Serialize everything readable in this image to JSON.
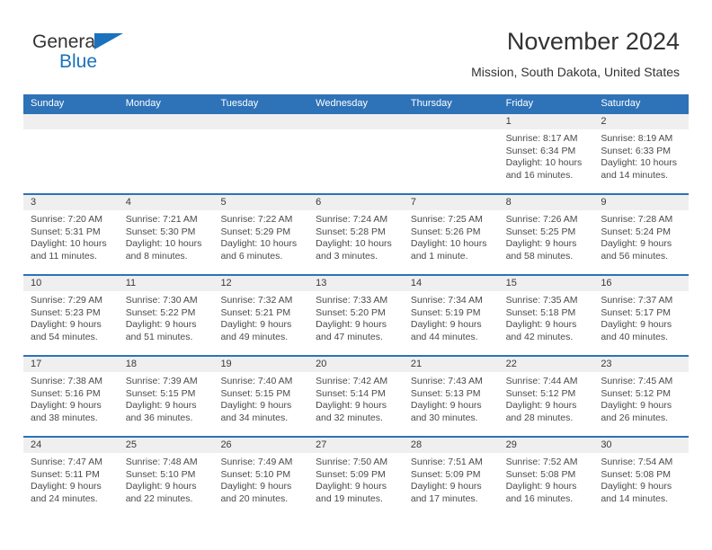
{
  "logo": {
    "line1": "General",
    "line2": "Blue",
    "triangle_color": "#1a72bd"
  },
  "header": {
    "title": "November 2024",
    "subtitle": "Mission, South Dakota, United States"
  },
  "theme": {
    "header_blue": "#2E72B8",
    "day_band_gray": "#EFEFEF",
    "text_color": "#333333"
  },
  "labels": {
    "sunrise_prefix": "Sunrise:",
    "sunset_prefix": "Sunset:",
    "daylight_prefix": "Daylight:"
  },
  "weekdays": [
    "Sunday",
    "Monday",
    "Tuesday",
    "Wednesday",
    "Thursday",
    "Friday",
    "Saturday"
  ],
  "weeks": [
    [
      {
        "day": "",
        "sunrise": "",
        "sunset": "",
        "daylight1": "",
        "daylight2": ""
      },
      {
        "day": "",
        "sunrise": "",
        "sunset": "",
        "daylight1": "",
        "daylight2": ""
      },
      {
        "day": "",
        "sunrise": "",
        "sunset": "",
        "daylight1": "",
        "daylight2": ""
      },
      {
        "day": "",
        "sunrise": "",
        "sunset": "",
        "daylight1": "",
        "daylight2": ""
      },
      {
        "day": "",
        "sunrise": "",
        "sunset": "",
        "daylight1": "",
        "daylight2": ""
      },
      {
        "day": "1",
        "sunrise": "Sunrise: 8:17 AM",
        "sunset": "Sunset: 6:34 PM",
        "daylight1": "Daylight: 10 hours",
        "daylight2": "and 16 minutes."
      },
      {
        "day": "2",
        "sunrise": "Sunrise: 8:19 AM",
        "sunset": "Sunset: 6:33 PM",
        "daylight1": "Daylight: 10 hours",
        "daylight2": "and 14 minutes."
      }
    ],
    [
      {
        "day": "3",
        "sunrise": "Sunrise: 7:20 AM",
        "sunset": "Sunset: 5:31 PM",
        "daylight1": "Daylight: 10 hours",
        "daylight2": "and 11 minutes."
      },
      {
        "day": "4",
        "sunrise": "Sunrise: 7:21 AM",
        "sunset": "Sunset: 5:30 PM",
        "daylight1": "Daylight: 10 hours",
        "daylight2": "and 8 minutes."
      },
      {
        "day": "5",
        "sunrise": "Sunrise: 7:22 AM",
        "sunset": "Sunset: 5:29 PM",
        "daylight1": "Daylight: 10 hours",
        "daylight2": "and 6 minutes."
      },
      {
        "day": "6",
        "sunrise": "Sunrise: 7:24 AM",
        "sunset": "Sunset: 5:28 PM",
        "daylight1": "Daylight: 10 hours",
        "daylight2": "and 3 minutes."
      },
      {
        "day": "7",
        "sunrise": "Sunrise: 7:25 AM",
        "sunset": "Sunset: 5:26 PM",
        "daylight1": "Daylight: 10 hours",
        "daylight2": "and 1 minute."
      },
      {
        "day": "8",
        "sunrise": "Sunrise: 7:26 AM",
        "sunset": "Sunset: 5:25 PM",
        "daylight1": "Daylight: 9 hours",
        "daylight2": "and 58 minutes."
      },
      {
        "day": "9",
        "sunrise": "Sunrise: 7:28 AM",
        "sunset": "Sunset: 5:24 PM",
        "daylight1": "Daylight: 9 hours",
        "daylight2": "and 56 minutes."
      }
    ],
    [
      {
        "day": "10",
        "sunrise": "Sunrise: 7:29 AM",
        "sunset": "Sunset: 5:23 PM",
        "daylight1": "Daylight: 9 hours",
        "daylight2": "and 54 minutes."
      },
      {
        "day": "11",
        "sunrise": "Sunrise: 7:30 AM",
        "sunset": "Sunset: 5:22 PM",
        "daylight1": "Daylight: 9 hours",
        "daylight2": "and 51 minutes."
      },
      {
        "day": "12",
        "sunrise": "Sunrise: 7:32 AM",
        "sunset": "Sunset: 5:21 PM",
        "daylight1": "Daylight: 9 hours",
        "daylight2": "and 49 minutes."
      },
      {
        "day": "13",
        "sunrise": "Sunrise: 7:33 AM",
        "sunset": "Sunset: 5:20 PM",
        "daylight1": "Daylight: 9 hours",
        "daylight2": "and 47 minutes."
      },
      {
        "day": "14",
        "sunrise": "Sunrise: 7:34 AM",
        "sunset": "Sunset: 5:19 PM",
        "daylight1": "Daylight: 9 hours",
        "daylight2": "and 44 minutes."
      },
      {
        "day": "15",
        "sunrise": "Sunrise: 7:35 AM",
        "sunset": "Sunset: 5:18 PM",
        "daylight1": "Daylight: 9 hours",
        "daylight2": "and 42 minutes."
      },
      {
        "day": "16",
        "sunrise": "Sunrise: 7:37 AM",
        "sunset": "Sunset: 5:17 PM",
        "daylight1": "Daylight: 9 hours",
        "daylight2": "and 40 minutes."
      }
    ],
    [
      {
        "day": "17",
        "sunrise": "Sunrise: 7:38 AM",
        "sunset": "Sunset: 5:16 PM",
        "daylight1": "Daylight: 9 hours",
        "daylight2": "and 38 minutes."
      },
      {
        "day": "18",
        "sunrise": "Sunrise: 7:39 AM",
        "sunset": "Sunset: 5:15 PM",
        "daylight1": "Daylight: 9 hours",
        "daylight2": "and 36 minutes."
      },
      {
        "day": "19",
        "sunrise": "Sunrise: 7:40 AM",
        "sunset": "Sunset: 5:15 PM",
        "daylight1": "Daylight: 9 hours",
        "daylight2": "and 34 minutes."
      },
      {
        "day": "20",
        "sunrise": "Sunrise: 7:42 AM",
        "sunset": "Sunset: 5:14 PM",
        "daylight1": "Daylight: 9 hours",
        "daylight2": "and 32 minutes."
      },
      {
        "day": "21",
        "sunrise": "Sunrise: 7:43 AM",
        "sunset": "Sunset: 5:13 PM",
        "daylight1": "Daylight: 9 hours",
        "daylight2": "and 30 minutes."
      },
      {
        "day": "22",
        "sunrise": "Sunrise: 7:44 AM",
        "sunset": "Sunset: 5:12 PM",
        "daylight1": "Daylight: 9 hours",
        "daylight2": "and 28 minutes."
      },
      {
        "day": "23",
        "sunrise": "Sunrise: 7:45 AM",
        "sunset": "Sunset: 5:12 PM",
        "daylight1": "Daylight: 9 hours",
        "daylight2": "and 26 minutes."
      }
    ],
    [
      {
        "day": "24",
        "sunrise": "Sunrise: 7:47 AM",
        "sunset": "Sunset: 5:11 PM",
        "daylight1": "Daylight: 9 hours",
        "daylight2": "and 24 minutes."
      },
      {
        "day": "25",
        "sunrise": "Sunrise: 7:48 AM",
        "sunset": "Sunset: 5:10 PM",
        "daylight1": "Daylight: 9 hours",
        "daylight2": "and 22 minutes."
      },
      {
        "day": "26",
        "sunrise": "Sunrise: 7:49 AM",
        "sunset": "Sunset: 5:10 PM",
        "daylight1": "Daylight: 9 hours",
        "daylight2": "and 20 minutes."
      },
      {
        "day": "27",
        "sunrise": "Sunrise: 7:50 AM",
        "sunset": "Sunset: 5:09 PM",
        "daylight1": "Daylight: 9 hours",
        "daylight2": "and 19 minutes."
      },
      {
        "day": "28",
        "sunrise": "Sunrise: 7:51 AM",
        "sunset": "Sunset: 5:09 PM",
        "daylight1": "Daylight: 9 hours",
        "daylight2": "and 17 minutes."
      },
      {
        "day": "29",
        "sunrise": "Sunrise: 7:52 AM",
        "sunset": "Sunset: 5:08 PM",
        "daylight1": "Daylight: 9 hours",
        "daylight2": "and 16 minutes."
      },
      {
        "day": "30",
        "sunrise": "Sunrise: 7:54 AM",
        "sunset": "Sunset: 5:08 PM",
        "daylight1": "Daylight: 9 hours",
        "daylight2": "and 14 minutes."
      }
    ]
  ]
}
